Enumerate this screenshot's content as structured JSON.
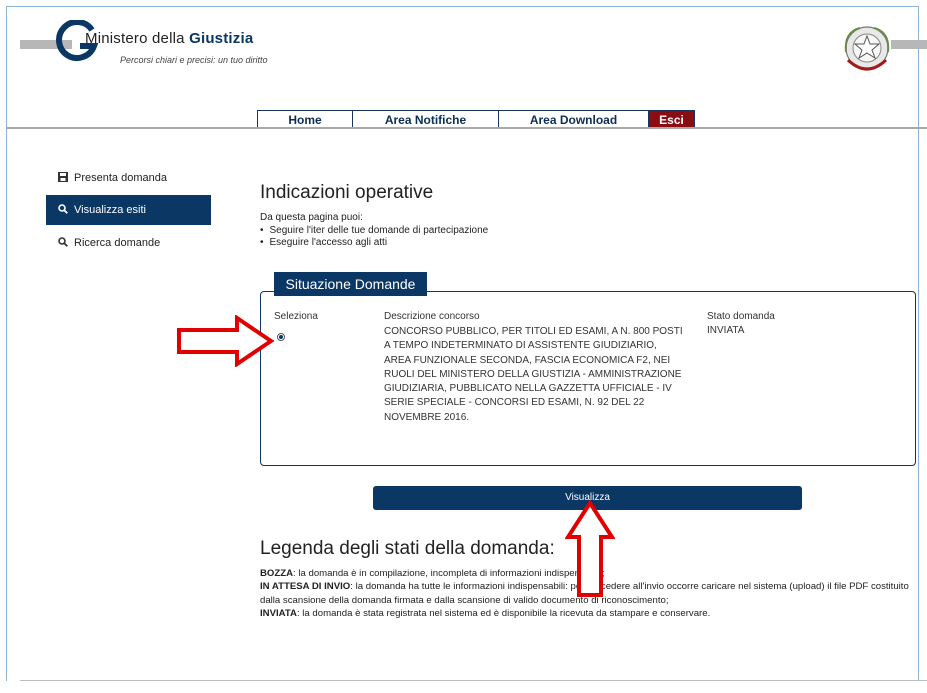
{
  "header": {
    "brand_prefix": "Ministero della ",
    "brand_bold": "Giustizia",
    "tagline": "Percorsi chiari e precisi: un tuo diritto"
  },
  "nav": {
    "tabs": [
      "Home",
      "Area Notifiche",
      "Area Download"
    ],
    "esci": "Esci"
  },
  "sidebar": {
    "items": [
      {
        "label": "Presenta domanda",
        "icon": "save-icon"
      },
      {
        "label": "Visualizza esiti",
        "icon": "search-icon",
        "active": true
      },
      {
        "label": "Ricerca domande",
        "icon": "search-icon"
      }
    ]
  },
  "main": {
    "title": "Indicazioni operative",
    "intro": "Da questa pagina puoi:",
    "bullets": [
      "Seguire l'iter delle tue domande di partecipazione",
      "Eseguire l'accesso agli atti"
    ],
    "box_title": "Situazione Domande",
    "columns": {
      "seleziona": "Seleziona",
      "descrizione": "Descrizione concorso",
      "stato": "Stato domanda"
    },
    "row": {
      "description": "CONCORSO PUBBLICO, PER TITOLI ED ESAMI, A N. 800 POSTI A TEMPO INDETERMINATO DI ASSISTENTE GIUDIZIARIO, AREA FUNZIONALE SECONDA, FASCIA ECONOMICA F2, NEI RUOLI DEL MINISTERO DELLA GIUSTIZIA - AMMINISTRAZIONE GIUDIZIARIA, PUBBLICATO NELLA GAZZETTA UFFICIALE - IV SERIE SPECIALE - CONCORSI ED ESAMI, N. 92 DEL 22 NOVEMBRE 2016.",
      "stato": "INVIATA",
      "selected": true
    },
    "button": "Visualizza",
    "legend_title": "Legenda degli stati della domanda:",
    "legend": [
      {
        "term": "BOZZA",
        "text": ": la domanda è in compilazione, incompleta di informazioni indispensabili;"
      },
      {
        "term": "IN ATTESA DI INVIO",
        "text": ": la domanda ha tutte le informazioni indispensabili: per procedere all'invio occorre caricare nel sistema (upload) il file PDF costituito dalla scansione della domanda firmata e dalla scansione di valido documento di riconoscimento;"
      },
      {
        "term": "INVIATA",
        "text": ": la domanda è stata registrata nel sistema ed è disponibile la ricevuta da stampare e conservare."
      }
    ]
  },
  "colors": {
    "primary": "#0b3765",
    "esci": "#8b0d14",
    "annotation_arrow": "#e00000"
  }
}
